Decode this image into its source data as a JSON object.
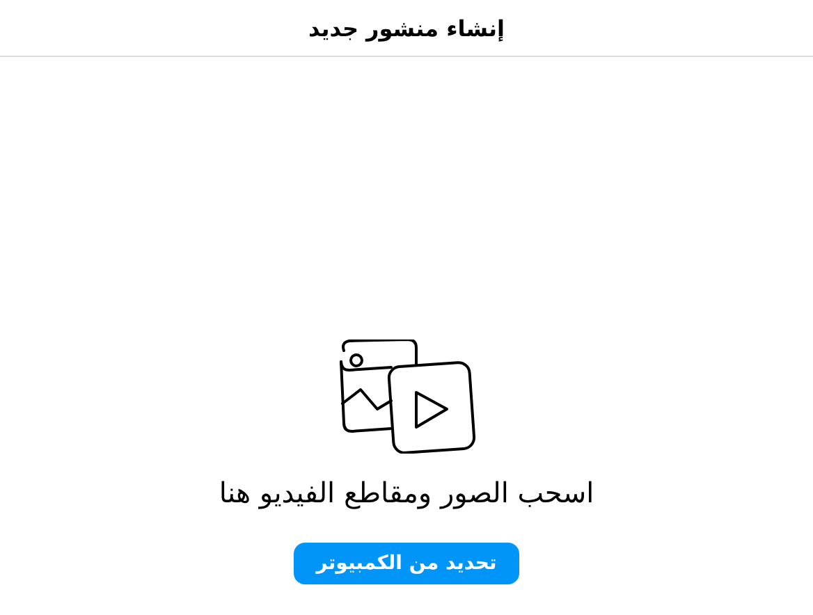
{
  "header": {
    "title": "إنشاء منشور جديد"
  },
  "upload": {
    "prompt": "اسحب الصور ومقاطع الفيديو هنا",
    "button": "تحديد من الكمبيوتر"
  }
}
